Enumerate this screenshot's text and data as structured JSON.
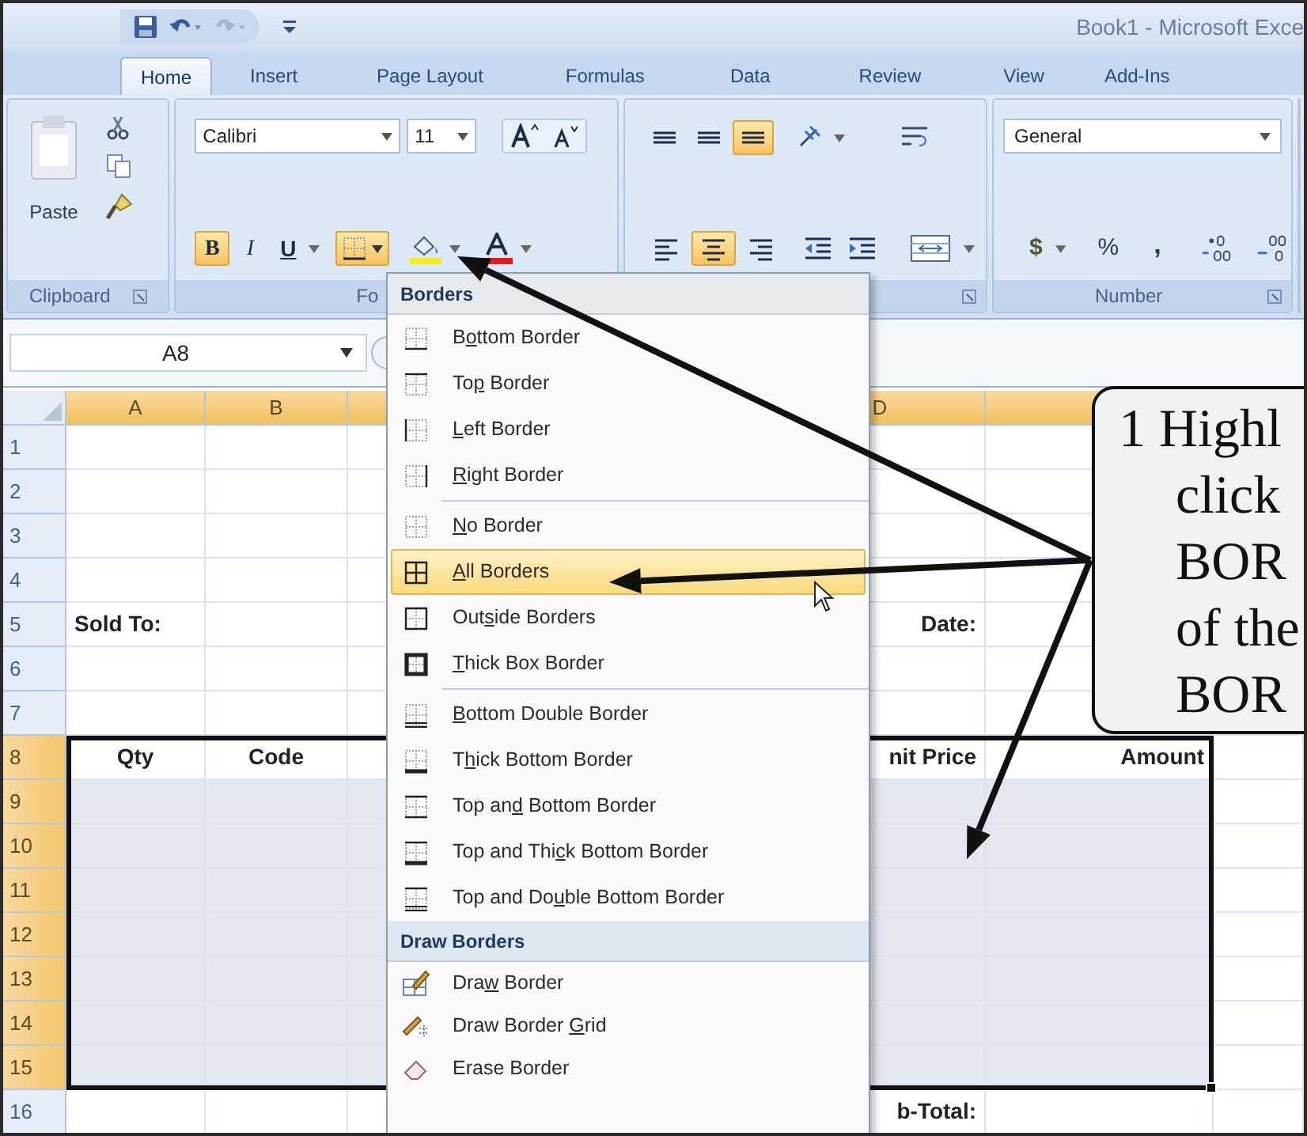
{
  "window": {
    "title": "Book1 - Microsoft Exce"
  },
  "tabs": [
    {
      "label": "Home",
      "selected": true
    },
    {
      "label": "Insert",
      "selected": false
    },
    {
      "label": "Page Layout",
      "selected": false
    },
    {
      "label": "Formulas",
      "selected": false
    },
    {
      "label": "Data",
      "selected": false
    },
    {
      "label": "Review",
      "selected": false
    },
    {
      "label": "View",
      "selected": false
    },
    {
      "label": "Add-Ins",
      "selected": false
    }
  ],
  "clipboard": {
    "paste_label": "Paste",
    "group_label": "Clipboard"
  },
  "font": {
    "name": "Calibri",
    "size": "11",
    "group_label": "Fo",
    "borders_open": true,
    "styles": [
      {
        "label": "B",
        "active": true
      },
      {
        "label": "I",
        "active": false
      },
      {
        "label": "U",
        "active": false
      }
    ]
  },
  "alignment": {
    "vertical": [
      {
        "selected": false
      },
      {
        "selected": false
      },
      {
        "selected": true
      }
    ],
    "horizontal": [
      {
        "selected": false
      },
      {
        "selected": true
      },
      {
        "selected": false
      }
    ]
  },
  "number": {
    "format": "General",
    "group_label": "Number",
    "currency": "$",
    "percent": "%",
    "comma": ","
  },
  "name_box": "A8",
  "columns": [
    {
      "label": "A",
      "selected": true
    },
    {
      "label": "B",
      "selected": true
    },
    {
      "selected": true
    },
    {
      "label": "D",
      "selected": true
    },
    {
      "selected": true
    }
  ],
  "rows": [
    {
      "label": "1",
      "selected": false,
      "shaded": false,
      "kind": "data"
    },
    {
      "label": "2",
      "selected": false,
      "shaded": false,
      "kind": "data"
    },
    {
      "label": "3",
      "selected": false,
      "shaded": false,
      "kind": "data"
    },
    {
      "label": "4",
      "selected": false,
      "shaded": false,
      "kind": "data"
    },
    {
      "label": "5",
      "selected": false,
      "shaded": false,
      "kind": "data",
      "cells": {
        "A": "Sold To:",
        "D": "Date:"
      }
    },
    {
      "label": "6",
      "selected": false,
      "shaded": false,
      "kind": "data"
    },
    {
      "label": "7",
      "selected": false,
      "shaded": false,
      "kind": "data"
    },
    {
      "label": "8",
      "selected": true,
      "shaded": false,
      "kind": "header",
      "cells": {
        "A": "Qty",
        "B": "Code",
        "D": "nit Price",
        "E": "Amount"
      }
    },
    {
      "label": "9",
      "selected": true,
      "shaded": true,
      "kind": "data"
    },
    {
      "label": "10",
      "selected": true,
      "shaded": true,
      "kind": "data"
    },
    {
      "label": "11",
      "selected": true,
      "shaded": true,
      "kind": "data"
    },
    {
      "label": "12",
      "selected": true,
      "shaded": true,
      "kind": "data"
    },
    {
      "label": "13",
      "selected": true,
      "shaded": true,
      "kind": "data"
    },
    {
      "label": "14",
      "selected": true,
      "shaded": true,
      "kind": "data"
    },
    {
      "label": "15",
      "selected": true,
      "shaded": true,
      "kind": "data"
    },
    {
      "label": "16",
      "selected": false,
      "shaded": false,
      "kind": "data",
      "cells": {
        "D": "b-Total:"
      }
    }
  ],
  "borders_menu": {
    "sections": [
      {
        "header": "Borders",
        "groups": [
          {
            "items": [
              {
                "before": "B",
                "key": "o",
                "after": "ttom Border",
                "selected": false
              },
              {
                "before": "To",
                "key": "p",
                "after": " Border",
                "selected": false
              },
              {
                "key": "L",
                "after": "eft Border",
                "selected": false
              },
              {
                "key": "R",
                "after": "ight Border",
                "selected": false
              }
            ]
          },
          {
            "items": [
              {
                "key": "N",
                "after": "o Border",
                "selected": false
              },
              {
                "key": "A",
                "after": "ll Borders",
                "selected": true
              },
              {
                "before": "Out",
                "key": "s",
                "after": "ide Borders",
                "selected": false
              },
              {
                "key": "T",
                "after": "hick Box Border",
                "selected": false
              }
            ]
          },
          {
            "items": [
              {
                "key": "B",
                "after": "ottom Double Border",
                "selected": false
              },
              {
                "before": "T",
                "key": "h",
                "after": "ick Bottom Border",
                "selected": false
              },
              {
                "before": "Top an",
                "key": "d",
                "after": " Bottom Border",
                "selected": false
              },
              {
                "before": "Top and Thi",
                "key": "c",
                "after": "k Bottom Border",
                "selected": false
              },
              {
                "before": "Top and Do",
                "key": "u",
                "after": "ble Bottom Border",
                "selected": false
              }
            ]
          }
        ]
      },
      {
        "header": "Draw Borders",
        "groups": [
          {
            "items": [
              {
                "before": "Dra",
                "key": "w",
                "after": " Border",
                "selected": false
              },
              {
                "before": "Draw Border ",
                "key": "G",
                "after": "rid",
                "selected": false
              },
              {
                "before": "Erase Border",
                "selected": false
              }
            ]
          }
        ]
      }
    ]
  },
  "callout": {
    "lines": [
      "1 Highl",
      "click",
      "BOR",
      "of the",
      "BOR"
    ]
  }
}
